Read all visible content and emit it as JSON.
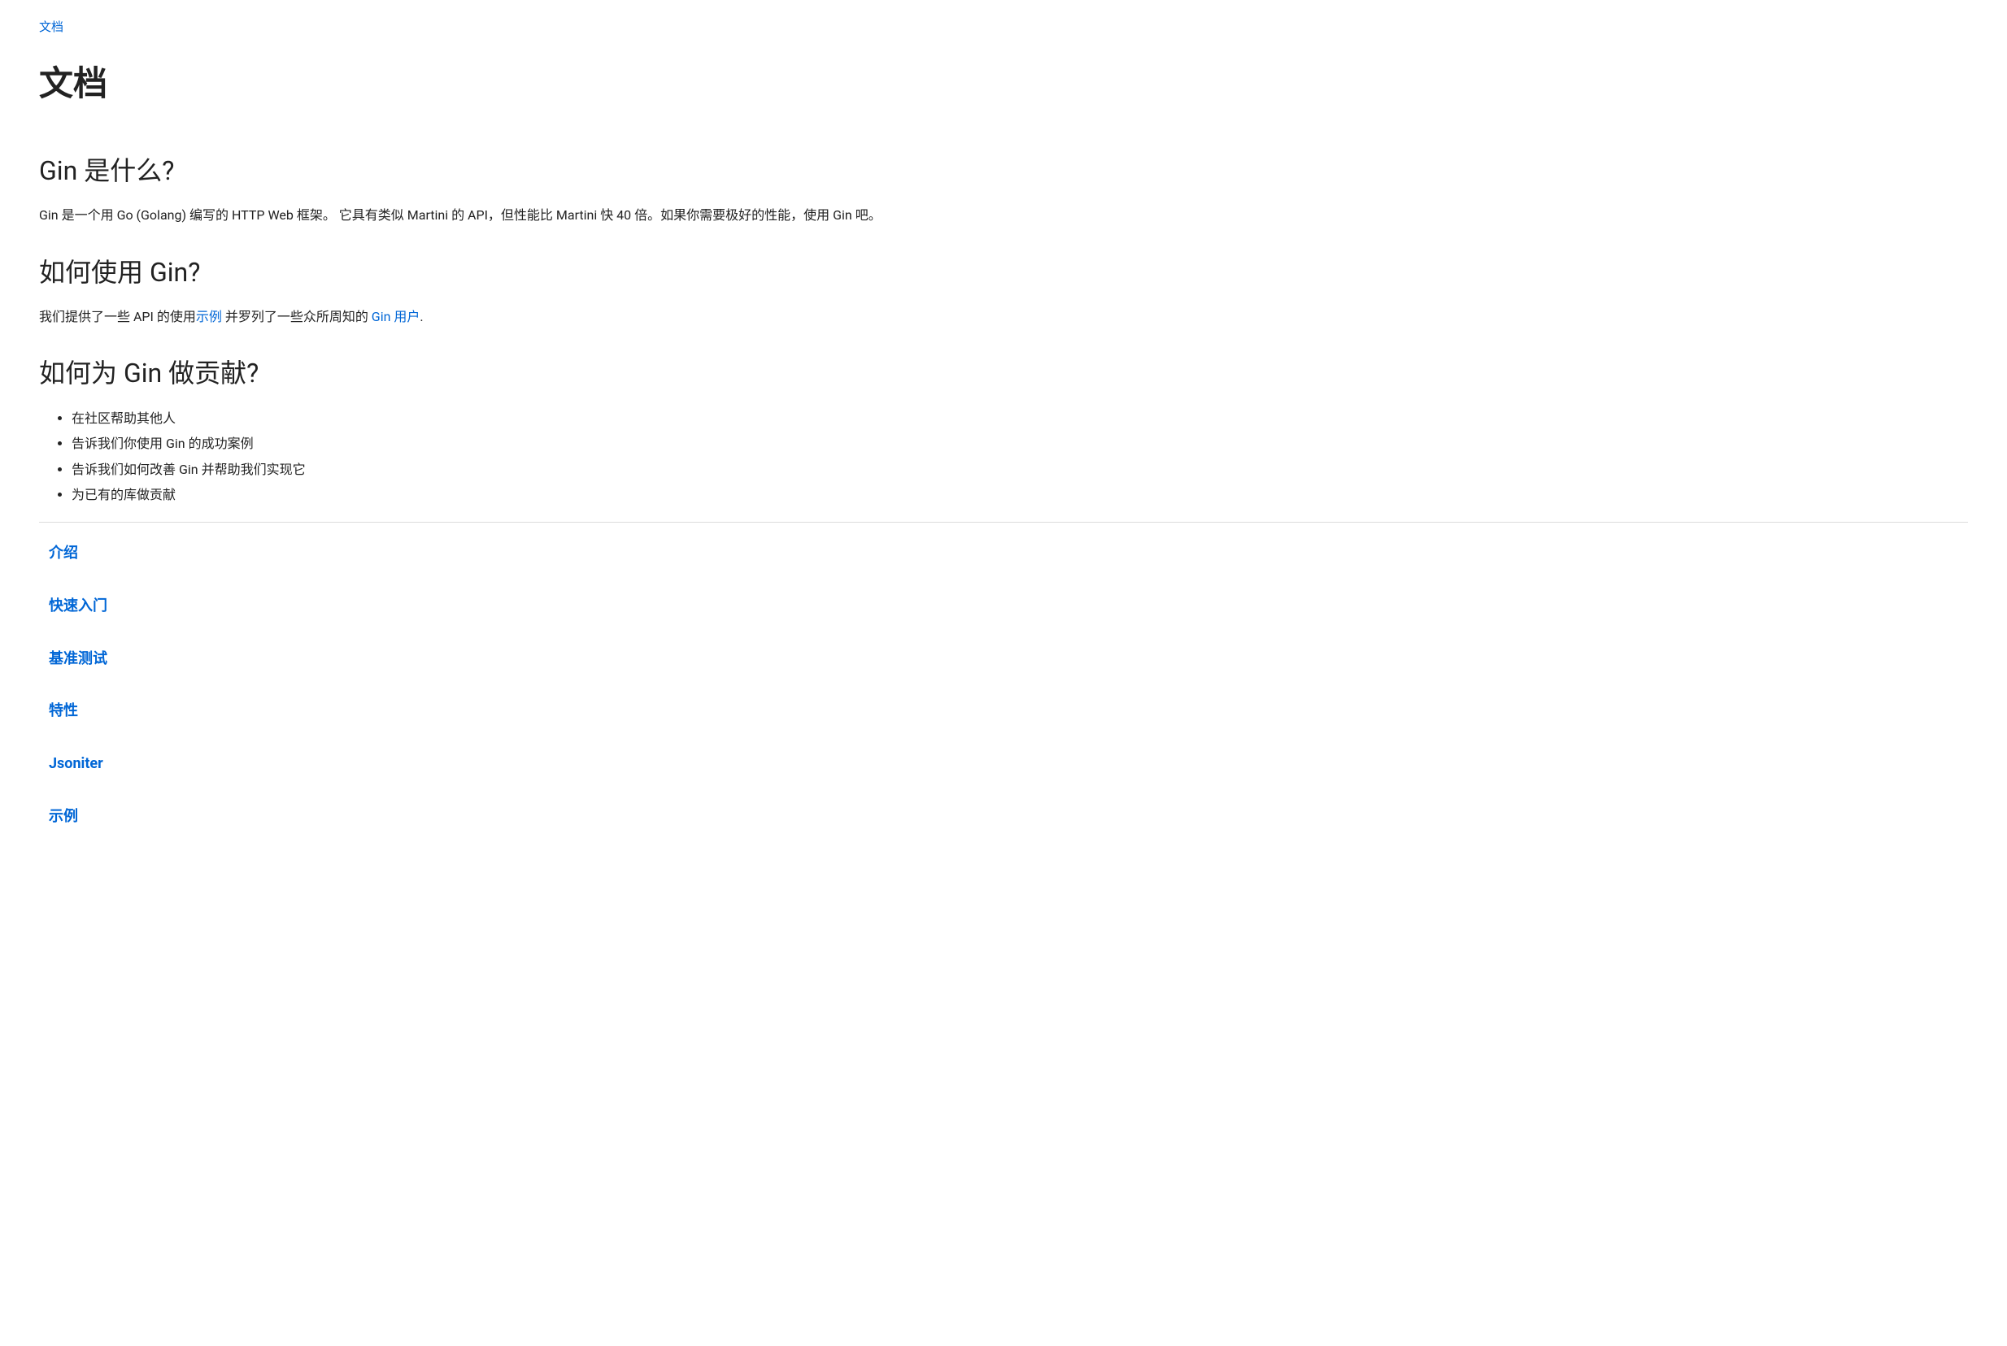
{
  "breadcrumb": {
    "label": "文档"
  },
  "title": "文档",
  "sections": {
    "what_is_gin": {
      "heading": "Gin 是什么?",
      "body": "Gin 是一个用 Go (Golang) 编写的 HTTP Web 框架。 它具有类似 Martini 的 API，但性能比 Martini 快 40 倍。如果你需要极好的性能，使用 Gin 吧。"
    },
    "how_to_use": {
      "heading": "如何使用 Gin?",
      "body_prefix": "我们提供了一些 API 的使用",
      "link_examples": "示例",
      "body_mid": " 并罗列了一些众所周知的 ",
      "link_users": "Gin 用户",
      "body_suffix": "."
    },
    "how_to_contribute": {
      "heading": "如何为 Gin 做贡献?",
      "items": [
        "在社区帮助其他人",
        "告诉我们你使用 Gin 的成功案例",
        "告诉我们如何改善 Gin 并帮助我们实现它",
        "为已有的库做贡献"
      ]
    }
  },
  "toc": [
    "介绍",
    "快速入门",
    "基准测试",
    "特性",
    "Jsoniter",
    "示例"
  ]
}
